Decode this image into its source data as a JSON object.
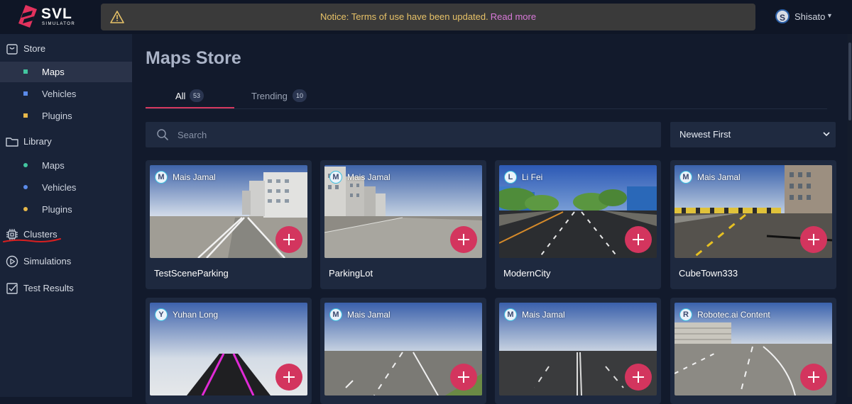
{
  "brand": {
    "name": "SVL",
    "subtitle": "SIMULATOR"
  },
  "notice": {
    "text": "Notice: Terms of use have been updated.",
    "link": "Read more"
  },
  "user": {
    "initial": "S",
    "name": "Shisato"
  },
  "sidebar": {
    "store": {
      "label": "Store",
      "icon": "shopping-bag-icon"
    },
    "store_items": [
      {
        "label": "Maps",
        "active": true,
        "color": "#43c6a0"
      },
      {
        "label": "Vehicles",
        "active": false,
        "color": "#5b8bea"
      },
      {
        "label": "Plugins",
        "active": false,
        "color": "#e7b84a"
      }
    ],
    "library": {
      "label": "Library",
      "icon": "folder-icon"
    },
    "library_items": [
      {
        "label": "Maps",
        "color": "#43c6a0"
      },
      {
        "label": "Vehicles",
        "color": "#5b8bea"
      },
      {
        "label": "Plugins",
        "color": "#e7b84a"
      }
    ],
    "clusters": {
      "label": "Clusters",
      "icon": "chip-icon"
    },
    "simulations": {
      "label": "Simulations",
      "icon": "play-circle-icon"
    },
    "test_results": {
      "label": "Test Results",
      "icon": "checklist-icon"
    }
  },
  "main": {
    "title": "Maps Store",
    "tabs": [
      {
        "label": "All",
        "count": "53",
        "active": true
      },
      {
        "label": "Trending",
        "count": "10",
        "active": false
      }
    ],
    "search": {
      "placeholder": "Search"
    },
    "sort": {
      "selected": "Newest First"
    },
    "cards": [
      {
        "author_initial": "M",
        "author": "Mais Jamal",
        "title": "TestSceneParking"
      },
      {
        "author_initial": "M",
        "author": "Mais Jamal",
        "title": "ParkingLot"
      },
      {
        "author_initial": "L",
        "author": "Li Fei",
        "title": "ModernCity"
      },
      {
        "author_initial": "M",
        "author": "Mais Jamal",
        "title": "CubeTown333"
      },
      {
        "author_initial": "Y",
        "author": "Yuhan Long",
        "title": ""
      },
      {
        "author_initial": "M",
        "author": "Mais Jamal",
        "title": ""
      },
      {
        "author_initial": "M",
        "author": "Mais Jamal",
        "title": ""
      },
      {
        "author_initial": "R",
        "author": "Robotec.ai Content",
        "title": ""
      }
    ]
  },
  "colors": {
    "accent": "#d3355e",
    "notice_text": "#e7c268",
    "notice_link": "#d879d8",
    "annotation": "#d82020"
  }
}
